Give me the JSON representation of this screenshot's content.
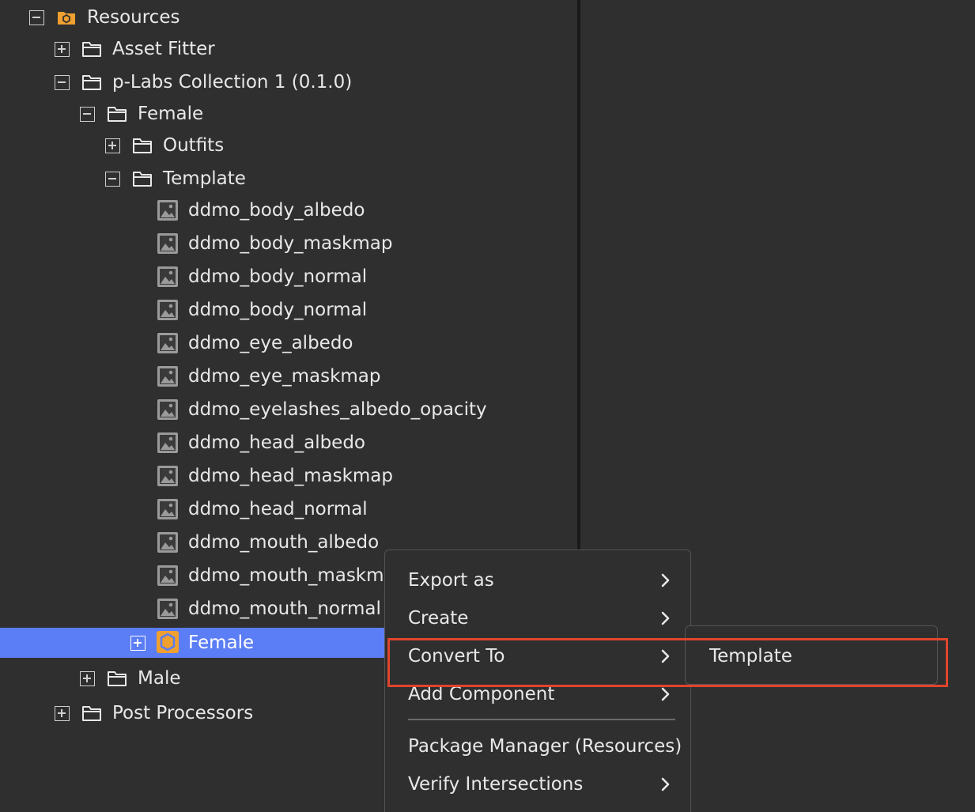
{
  "tree": {
    "items": [
      {
        "label": "Resources",
        "icon": "resources-package-icon",
        "expanded": true
      },
      {
        "label": "Asset Fitter",
        "icon": "folder-icon",
        "expanded": false
      },
      {
        "label": "p-Labs Collection 1 (0.1.0)",
        "icon": "folder-icon",
        "expanded": true
      },
      {
        "label": "Female",
        "icon": "folder-icon",
        "expanded": true
      },
      {
        "label": "Outfits",
        "icon": "folder-icon",
        "expanded": false
      },
      {
        "label": "Template",
        "icon": "folder-icon",
        "expanded": true
      },
      {
        "label": "ddmo_body_albedo",
        "icon": "image-icon"
      },
      {
        "label": "ddmo_body_maskmap",
        "icon": "image-icon"
      },
      {
        "label": "ddmo_body_normal",
        "icon": "image-icon"
      },
      {
        "label": "ddmo_body_normal",
        "icon": "image-icon"
      },
      {
        "label": "ddmo_eye_albedo",
        "icon": "image-icon"
      },
      {
        "label": "ddmo_eye_maskmap",
        "icon": "image-icon"
      },
      {
        "label": "ddmo_eyelashes_albedo_opacity",
        "icon": "image-icon"
      },
      {
        "label": "ddmo_head_albedo",
        "icon": "image-icon"
      },
      {
        "label": "ddmo_head_maskmap",
        "icon": "image-icon"
      },
      {
        "label": "ddmo_head_normal",
        "icon": "image-icon"
      },
      {
        "label": "ddmo_mouth_albedo",
        "icon": "image-icon"
      },
      {
        "label": "ddmo_mouth_maskma",
        "icon": "image-icon"
      },
      {
        "label": "ddmo_mouth_normal",
        "icon": "image-icon"
      },
      {
        "label": "Female",
        "icon": "template-hexagon-icon",
        "expanded": false,
        "selected": true
      },
      {
        "label": "Male",
        "icon": "folder-icon",
        "expanded": false
      },
      {
        "label": "Post Processors",
        "icon": "folder-icon",
        "expanded": false
      }
    ]
  },
  "context_menu": {
    "items": [
      {
        "label": "Export as",
        "has_submenu": true
      },
      {
        "label": "Create",
        "has_submenu": true
      },
      {
        "label": "Convert To",
        "has_submenu": true,
        "active": true
      },
      {
        "label": "Add Component",
        "has_submenu": true
      },
      {
        "label": "Package Manager (Resources)",
        "has_submenu": false
      },
      {
        "label": "Verify Intersections",
        "has_submenu": true
      }
    ]
  },
  "submenu": {
    "items": [
      {
        "label": "Template"
      }
    ]
  },
  "colors": {
    "background": "#2f2f2f",
    "selection": "#5b7df5",
    "accent_orange": "#f0a030",
    "highlight_box": "#e0452c"
  }
}
